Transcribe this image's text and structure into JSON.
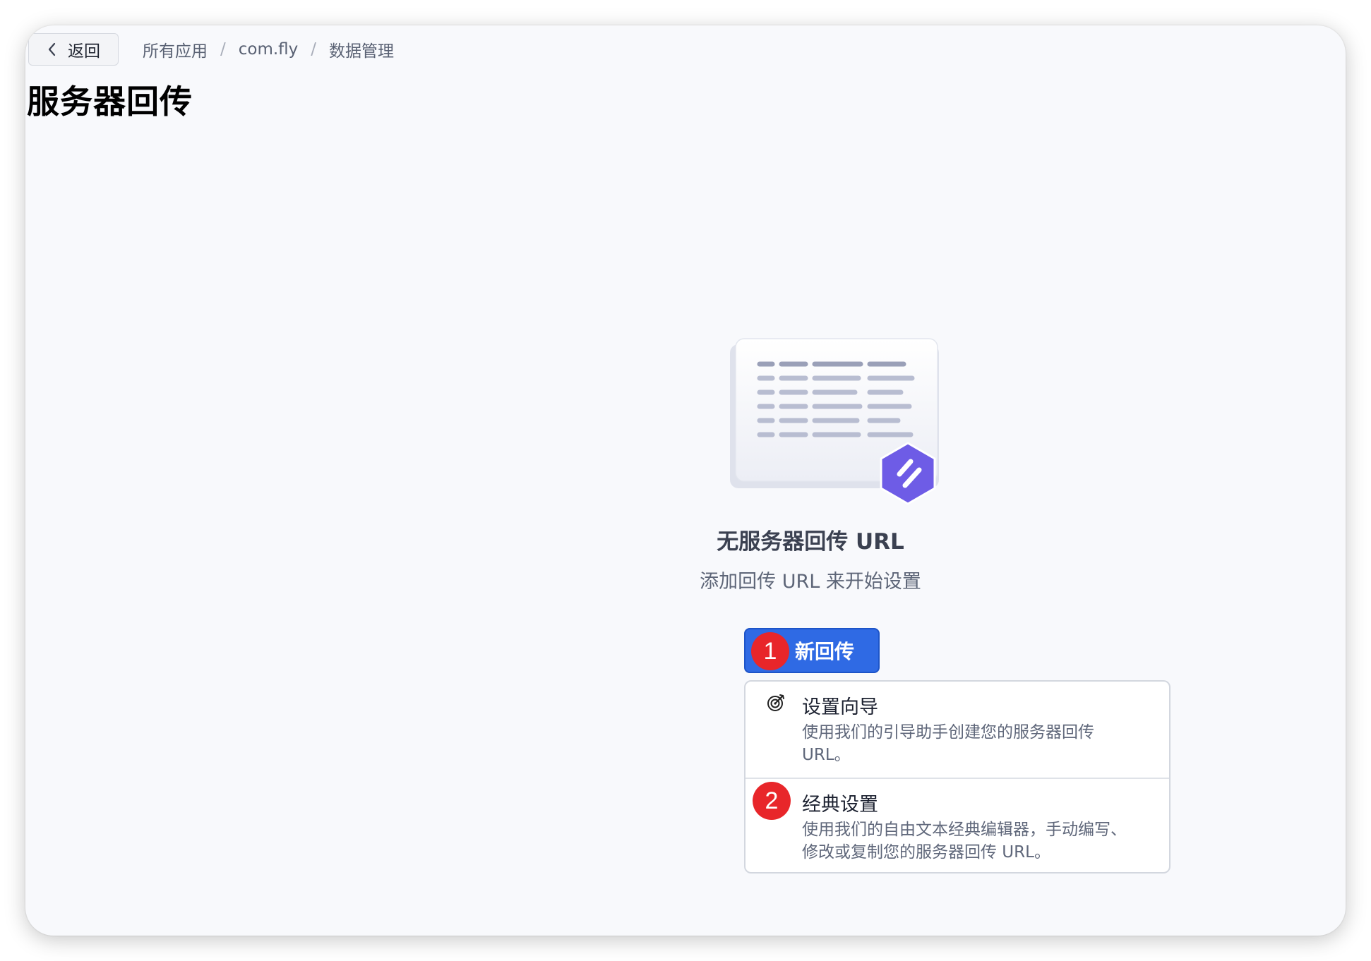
{
  "topbar": {
    "back_label": "返回",
    "breadcrumb": [
      "所有应用",
      "com.fly",
      "数据管理"
    ],
    "separator": "/"
  },
  "page": {
    "title": "服务器回传"
  },
  "empty_state": {
    "title": "无服务器回传 URL",
    "subtitle": "添加回传 URL 来开始设置",
    "illustration": "document-list-icon"
  },
  "new_button": {
    "label": "新回传",
    "badge": "1"
  },
  "dropdown": {
    "items": [
      {
        "label": "设置向导",
        "description": "使用我们的引导助手创建您的服务器回传 URL。",
        "icon": "target-icon"
      },
      {
        "label": "经典设置",
        "description": "使用我们的自由文本经典编辑器，手动编写、修改或复制您的服务器回传 URL。",
        "badge": "2"
      }
    ]
  },
  "colors": {
    "primary": "#2f6ae4",
    "badge": "#e8262a",
    "hexagon": "#6e5ce6",
    "background": "#f8f9fc"
  }
}
